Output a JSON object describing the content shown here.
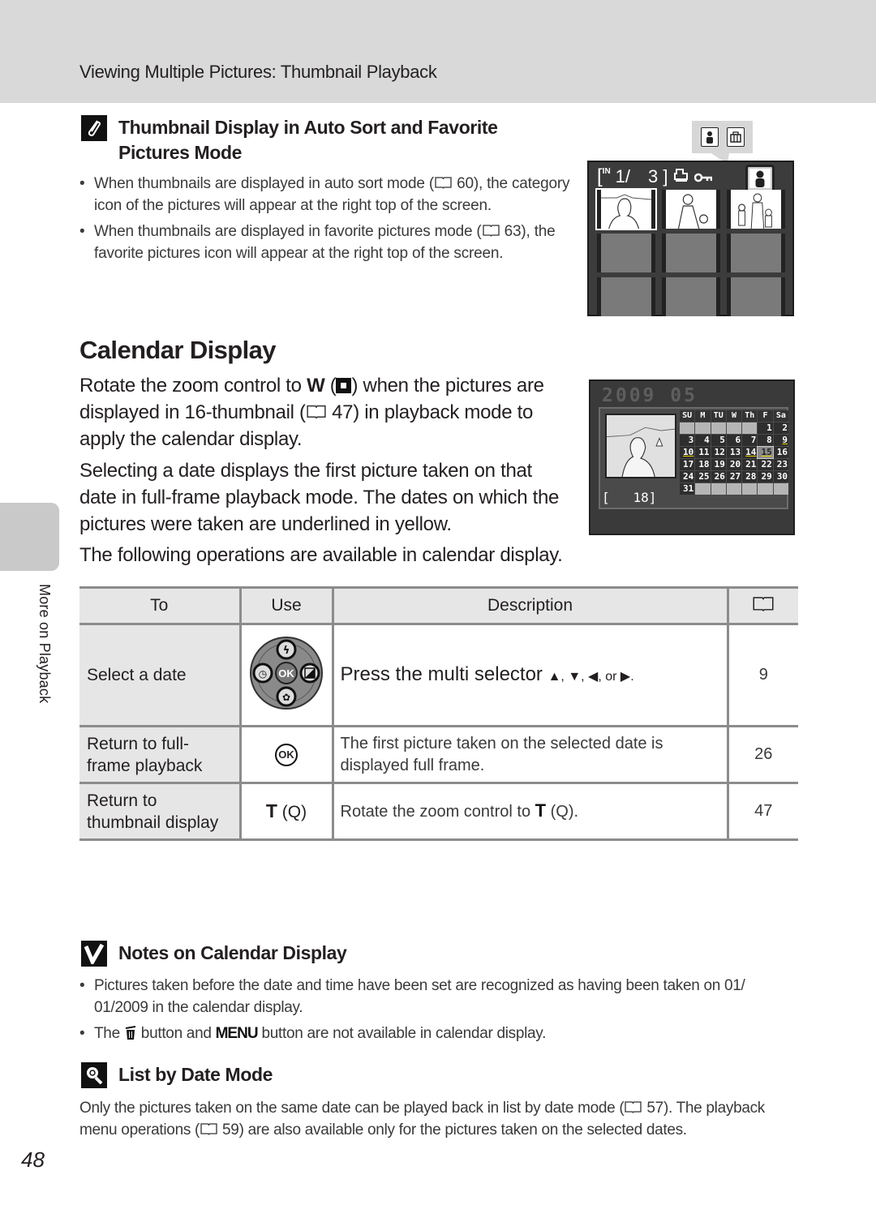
{
  "header": {
    "title": "Viewing Multiple Pictures: Thumbnail Playback"
  },
  "side_tab": {
    "label": "More on Playback"
  },
  "thumbnail_note": {
    "icon": "paperclip-icon",
    "title_line1": "Thumbnail Display in Auto Sort and Favorite",
    "title_line2": "Pictures Mode",
    "bullets": [
      {
        "before": "When thumbnails are displayed in auto sort mode (",
        "ref": "60",
        "after": "), the category icon of the pictures will appear at the right top of the screen."
      },
      {
        "before": "When thumbnails are displayed in favorite pictures mode (",
        "ref": "63",
        "after": "), the favorite pictures icon will appear at the right top of the screen."
      }
    ]
  },
  "thumb_screen": {
    "callout_icons": [
      "portrait-category-icon",
      "gift-box-category-icon"
    ],
    "memory_label": "IN",
    "current": "1/",
    "total": "3 ]",
    "status_icons": [
      "print-order-icon",
      "protect-key-icon",
      "portrait-category-icon"
    ],
    "thumbnails": [
      {
        "kind": "photo",
        "selected": true,
        "subject": "woman-portrait"
      },
      {
        "kind": "photo",
        "selected": false,
        "subject": "woman-with-child"
      },
      {
        "kind": "photo",
        "selected": false,
        "subject": "family-group"
      },
      {
        "kind": "blank"
      },
      {
        "kind": "blank"
      },
      {
        "kind": "blank"
      },
      {
        "kind": "blank"
      },
      {
        "kind": "blank"
      },
      {
        "kind": "blank"
      }
    ]
  },
  "calendar_section": {
    "title": "Calendar Display",
    "para1_a": "Rotate the zoom control to ",
    "para1_W": "W",
    "para1_b": " when the pictures are displayed in 16-thumbnail (",
    "para1_ref": "47",
    "para1_c": ") in playback mode to apply the calendar display.",
    "para2": "Selecting a date displays the first picture taken on that date in full-frame playback mode. The dates on which the pictures were taken are underlined in yellow.",
    "para3": "The following operations are available in calendar display."
  },
  "calendar_screen": {
    "year": "2009",
    "month": "05",
    "counter": "[   18]",
    "weekdays": [
      "SU",
      "M",
      "TU",
      "W",
      "Th",
      "F",
      "Sa"
    ],
    "leading_blanks": 5,
    "days_in_month": 31,
    "taken_dates": [
      9,
      10,
      14,
      15
    ],
    "selected_date": 15,
    "colors": {
      "underline": "#e8d000"
    }
  },
  "operations_table": {
    "headers": {
      "to": "To",
      "use": "Use",
      "description": "Description",
      "ref_icon": "book-reference-icon"
    },
    "rows": [
      {
        "to": "Select a date",
        "use_icon": "multi-selector-icon",
        "use_text": "",
        "description_before": "Press the multi selector ",
        "description_arrows": "▲, ▼, ◀, or ▶.",
        "page": "9"
      },
      {
        "to_line1": "Return to full-",
        "to_line2": "frame playback",
        "use_icon": "ok-button-icon",
        "use_text": "OK",
        "description": "The first picture taken on the selected date is displayed full frame.",
        "page": "26"
      },
      {
        "to_line1": "Return to",
        "to_line2": "thumbnail display",
        "use_icon": "zoom-tele-icon",
        "use_text": "T",
        "use_suffix": "(Q)",
        "description_before": "Rotate the zoom control to ",
        "description_T": "T",
        "description_after": " (Q).",
        "page": "47"
      }
    ]
  },
  "notes": {
    "icon": "checkmark-note-icon",
    "title": "Notes on Calendar Display",
    "bullet1": "Pictures taken before the date and time have been set are recognized as having been taken on 01/ 01/2009 in the calendar display.",
    "bullet2_a": "The ",
    "bullet2_trash": "trash-icon",
    "bullet2_b": " button and ",
    "bullet2_menu": "MENU",
    "bullet2_c": " button are not available in calendar display."
  },
  "list_by_date": {
    "icon": "lightbulb-tip-icon",
    "title": "List by Date Mode",
    "para_a": "Only the pictures taken on the same date can be played back in list by date mode (",
    "ref1": "57",
    "para_b": "). The playback menu operations (",
    "ref2": "59",
    "para_c": ") are also available only for the pictures taken on the selected dates."
  },
  "page_number": "48"
}
